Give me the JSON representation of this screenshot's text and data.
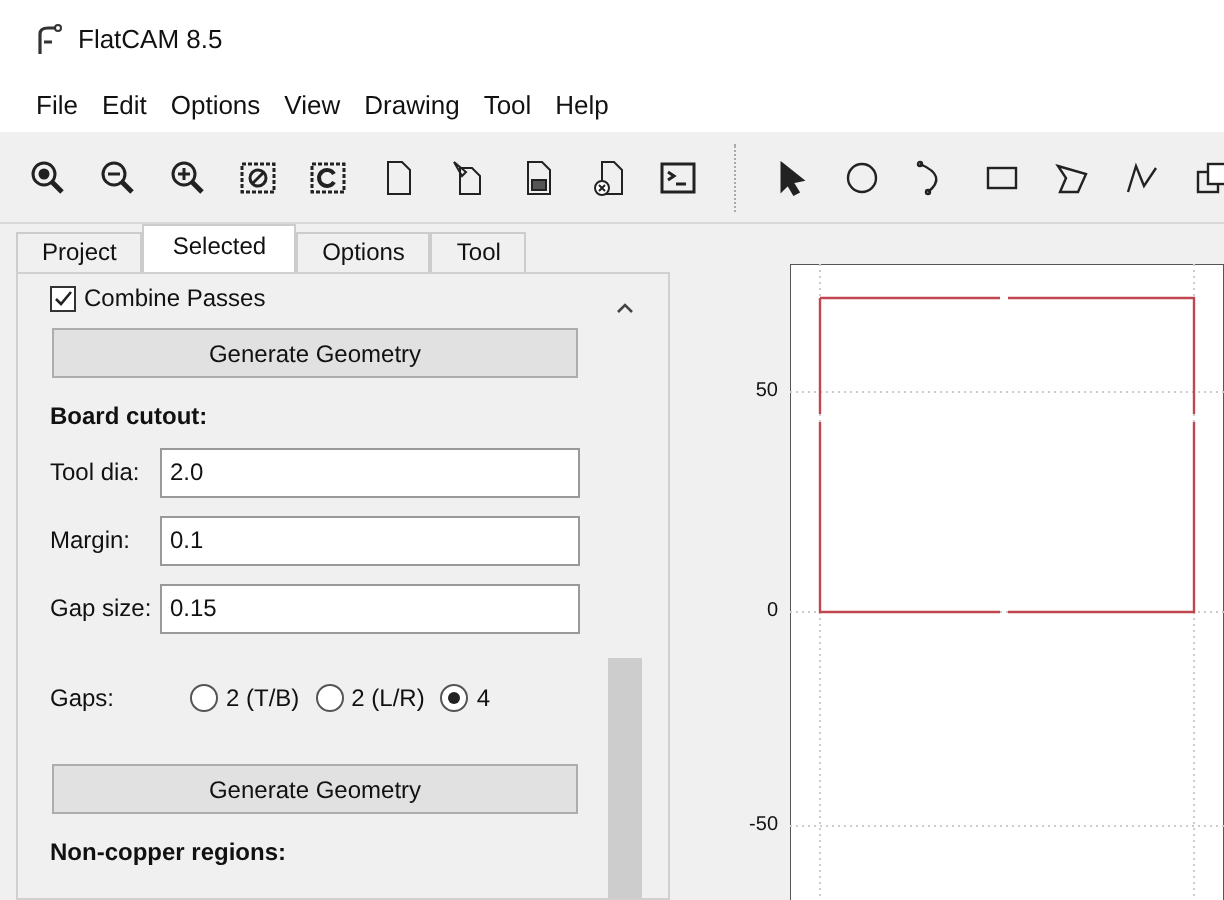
{
  "window": {
    "title": "FlatCAM 8.5"
  },
  "menu": [
    "File",
    "Edit",
    "Options",
    "View",
    "Drawing",
    "Tool",
    "Help"
  ],
  "tabs": [
    {
      "label": "Project",
      "selected": false
    },
    {
      "label": "Selected",
      "selected": true
    },
    {
      "label": "Options",
      "selected": false
    },
    {
      "label": "Tool",
      "selected": false
    }
  ],
  "panel": {
    "items": [
      {
        "kind": "checkbox",
        "label": "Combine Passes",
        "checked": true
      },
      {
        "kind": "button",
        "label": "Generate Geometry"
      },
      {
        "kind": "heading",
        "label": "Board cutout:"
      },
      {
        "kind": "field",
        "label": "Tool dia:",
        "value": "2.0"
      },
      {
        "kind": "field",
        "label": "Margin:",
        "value": "0.1"
      },
      {
        "kind": "field",
        "label": "Gap size:",
        "value": "0.15"
      },
      {
        "kind": "radio",
        "label": "Gaps:",
        "options": [
          {
            "label": "2 (T/B)",
            "selected": false
          },
          {
            "label": "2 (L/R)",
            "selected": false
          },
          {
            "label": "4",
            "selected": true
          }
        ]
      },
      {
        "kind": "button",
        "label": "Generate Geometry"
      },
      {
        "kind": "heading",
        "label": "Non-copper regions:"
      }
    ]
  },
  "plot": {
    "y_labels": [
      "50",
      "0",
      "-50"
    ]
  }
}
